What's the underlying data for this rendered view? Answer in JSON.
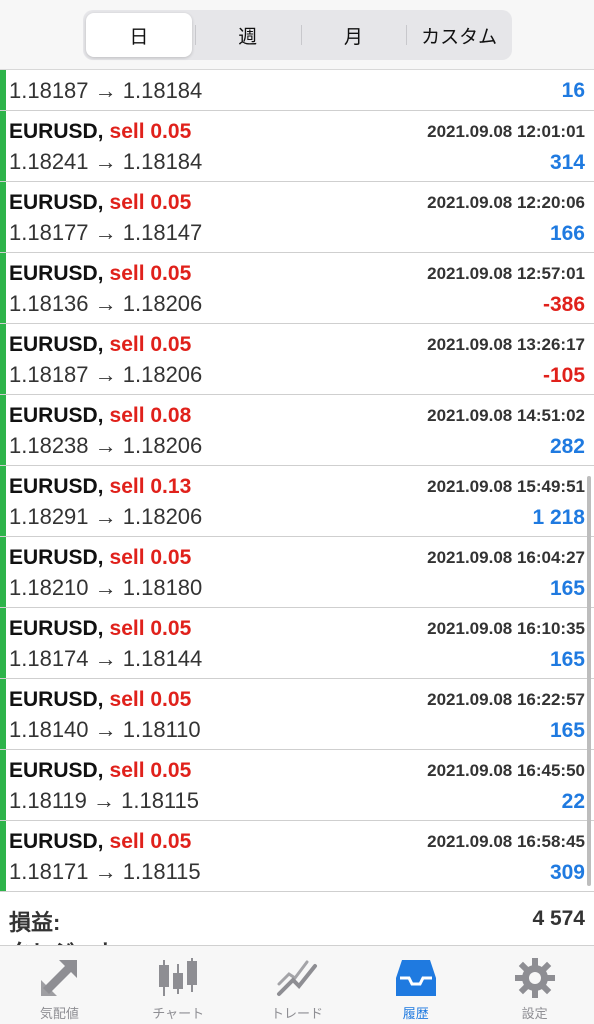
{
  "period_tabs": [
    "日",
    "週",
    "月",
    "カスタム"
  ],
  "active_period": "日",
  "partial_row": {
    "prices": "1.18187 → 1.18184",
    "profit": "16",
    "profit_sign": "pos"
  },
  "trades": [
    {
      "symbol": "EURUSD,",
      "action": "sell 0.05",
      "time": "2021.09.08 12:01:01",
      "prices": "1.18241 → 1.18184",
      "profit": "314",
      "profit_sign": "pos"
    },
    {
      "symbol": "EURUSD,",
      "action": "sell 0.05",
      "time": "2021.09.08 12:20:06",
      "prices": "1.18177 → 1.18147",
      "profit": "166",
      "profit_sign": "pos"
    },
    {
      "symbol": "EURUSD,",
      "action": "sell 0.05",
      "time": "2021.09.08 12:57:01",
      "prices": "1.18136 → 1.18206",
      "profit": "-386",
      "profit_sign": "neg"
    },
    {
      "symbol": "EURUSD,",
      "action": "sell 0.05",
      "time": "2021.09.08 13:26:17",
      "prices": "1.18187 → 1.18206",
      "profit": "-105",
      "profit_sign": "neg"
    },
    {
      "symbol": "EURUSD,",
      "action": "sell 0.08",
      "time": "2021.09.08 14:51:02",
      "prices": "1.18238 → 1.18206",
      "profit": "282",
      "profit_sign": "pos"
    },
    {
      "symbol": "EURUSD,",
      "action": "sell 0.13",
      "time": "2021.09.08 15:49:51",
      "prices": "1.18291 → 1.18206",
      "profit": "1 218",
      "profit_sign": "pos"
    },
    {
      "symbol": "EURUSD,",
      "action": "sell 0.05",
      "time": "2021.09.08 16:04:27",
      "prices": "1.18210 → 1.18180",
      "profit": "165",
      "profit_sign": "pos"
    },
    {
      "symbol": "EURUSD,",
      "action": "sell 0.05",
      "time": "2021.09.08 16:10:35",
      "prices": "1.18174 → 1.18144",
      "profit": "165",
      "profit_sign": "pos"
    },
    {
      "symbol": "EURUSD,",
      "action": "sell 0.05",
      "time": "2021.09.08 16:22:57",
      "prices": "1.18140 → 1.18110",
      "profit": "165",
      "profit_sign": "pos"
    },
    {
      "symbol": "EURUSD,",
      "action": "sell 0.05",
      "time": "2021.09.08 16:45:50",
      "prices": "1.18119 → 1.18115",
      "profit": "22",
      "profit_sign": "pos"
    },
    {
      "symbol": "EURUSD,",
      "action": "sell 0.05",
      "time": "2021.09.08 16:58:45",
      "prices": "1.18171 → 1.18115",
      "profit": "309",
      "profit_sign": "pos"
    }
  ],
  "summary": {
    "label": "損益:",
    "value": "4 574",
    "next_label": "クレジット"
  },
  "tabbar": [
    {
      "label": "気配値",
      "icon": "quotes-arrows-icon",
      "active": false
    },
    {
      "label": "チャート",
      "icon": "candlestick-chart-icon",
      "active": false
    },
    {
      "label": "トレード",
      "icon": "trade-line-chart-icon",
      "active": false
    },
    {
      "label": "履歴",
      "icon": "history-tray-icon",
      "active": true
    },
    {
      "label": "設定",
      "icon": "settings-gear-icon",
      "active": false
    }
  ],
  "colors": {
    "buy_bar": "#2db34a",
    "sell_text": "#e0211b",
    "profit_pos": "#1f7ae0",
    "profit_neg": "#e0211b",
    "active_tab": "#1f7ae0",
    "inactive_tab": "#8e8e93"
  }
}
